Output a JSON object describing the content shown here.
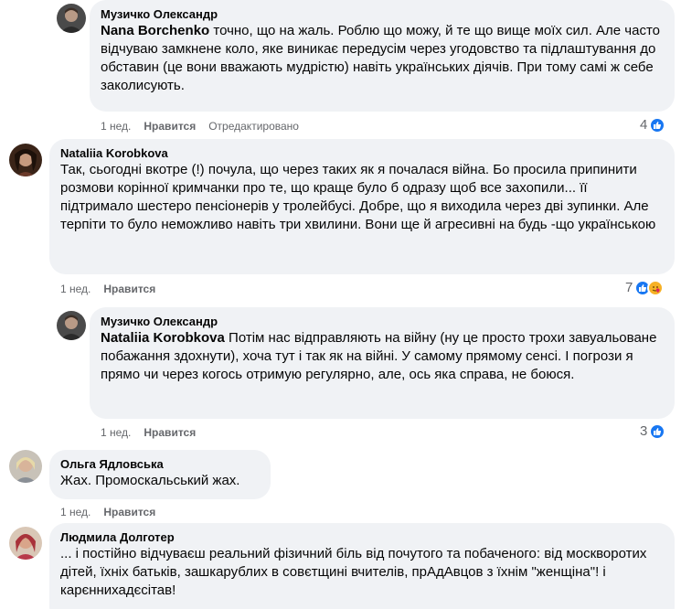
{
  "comments": [
    {
      "author": "Музичко Олександр",
      "mention": "Nana Borchenko",
      "text": " точно, що на жаль. Роблю що можу, й те що вище моїх сил. Але часто відчуваю замкнене коло, яке виникає передусім через угодовство та підлаштування до обставин (це вони вважають мудрістю) навіть українських діячів. При тому самі ж себе заколисують.",
      "time": "1 нед.",
      "like_label": "Нравится",
      "edited_label": "Отредактировано",
      "reaction_count": "4"
    },
    {
      "author": "Nataliia Korobkova",
      "text": "Так, сьогодні вкотре (!) почула, що через таких як я почалася війна. Бо просила припинити розмови корінної кримчанки про те, що краще було б одразу щоб все захопили... її підтримало шестеро пенсіонерів у тролейбусі. Добре, що я виходила через дві зупинки. Але терпіти то було неможливо навіть три хвилини. Вони ще й агресивні на будь -що українською",
      "time": "1 нед.",
      "like_label": "Нравится",
      "reaction_count": "7"
    },
    {
      "author": "Музичко Олександр",
      "mention": "Nataliia Korobkova",
      "text": " Потім нас відправляють на війну (ну це просто трохи завуальоване побажання здохнути), хоча тут і так як на війні. У самому прямому сенсі. І погрози я прямо чи через когось отримую регулярно, але, ось яка справа, не боюся.",
      "time": "1 нед.",
      "like_label": "Нравится",
      "reaction_count": "3"
    },
    {
      "author": "Ольга Ядловська",
      "text": "Жах. Промоскальський жах.",
      "time": "1 нед.",
      "like_label": "Нравится"
    },
    {
      "author": "Людмила Долготер",
      "text": "... і постійно відчуваєш реальний фізичний біль від почутого та побаченого: від москворотих дітей, їхніх батьків, зашкарублих в совєтщині вчителів, прАдАвцов з їхнім \"женщіна\"! і карєннихадєсітав!"
    }
  ],
  "colors": {
    "bubble": "#f0f2f5",
    "like_blue": "#1877f2",
    "care_yellow": "#f7b125",
    "meta_gray": "#65676b"
  }
}
